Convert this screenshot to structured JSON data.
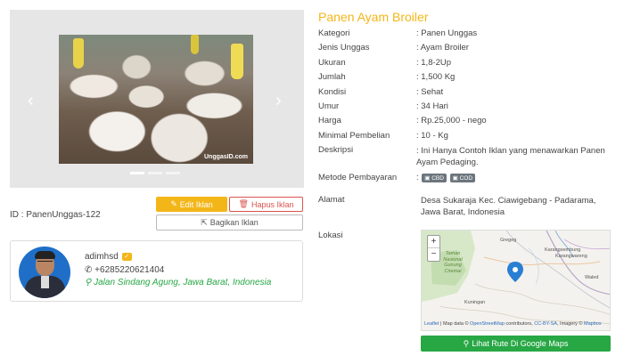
{
  "listing": {
    "title": "Panen Ayam Broiler",
    "id_label": "ID : PanenUnggas-122",
    "image": {
      "watermark": "UnggasID.com",
      "slide_count": 3,
      "active_slide": 1
    },
    "actions": {
      "edit_label": "Edit Iklan",
      "delete_label": "Hapus Iklan",
      "share_label": "Bagikan Iklan"
    }
  },
  "seller": {
    "name": "adimhsd",
    "phone": "+6285220621404",
    "address": "Jalan Sindang Agung, Jawa Barat, Indonesia"
  },
  "specs": [
    {
      "key": "Kategori",
      "value": ": Panen Unggas"
    },
    {
      "key": "Jenis Unggas",
      "value": ": Ayam Broiler"
    },
    {
      "key": "Ukuran",
      "value": ": 1,8-2Up"
    },
    {
      "key": "Jumlah",
      "value": ": 1,500 Kg"
    },
    {
      "key": "Kondisi",
      "value": ": Sehat"
    },
    {
      "key": "Umur",
      "value": ": 34 Hari"
    },
    {
      "key": "Harga",
      "value": ": Rp.25,000 - nego"
    },
    {
      "key": "Minimal Pembelian",
      "value": ": 10 - Kg"
    },
    {
      "key": "Deskripsi",
      "value": ": Ini Hanya Contoh Iklan yang menawarkan Panen Ayam Pedaging."
    }
  ],
  "payment": {
    "key": "Metode Pembayaran",
    "prefix": ":",
    "methods": [
      "CBD",
      "COD"
    ]
  },
  "address": {
    "key": "Alamat",
    "value": "Desa Sukaraja Kec. Ciawigebang - Padarama, Jawa Barat, Indonesia"
  },
  "location": {
    "key": "Lokasi",
    "map": {
      "zoom_in": "+",
      "zoom_out": "−",
      "labels": {
        "gregeg": "Gregeg",
        "karangsembung": "Karangsembung",
        "karangwareng": "Karangwareng",
        "park": "Taman Nasional Gunung Ciremai",
        "waled": "Waled",
        "kuningan": "Kuningan"
      },
      "attribution": {
        "leaflet": "Leaflet",
        "text1": " | Map data © ",
        "osm": "OpenStreetMap",
        "text2": " contributors, ",
        "license": "CC-BY-SA",
        "text3": ", Imagery © ",
        "mapbox": "Mapbox"
      }
    },
    "route_button": "Lihat Rute Di Google Maps"
  }
}
